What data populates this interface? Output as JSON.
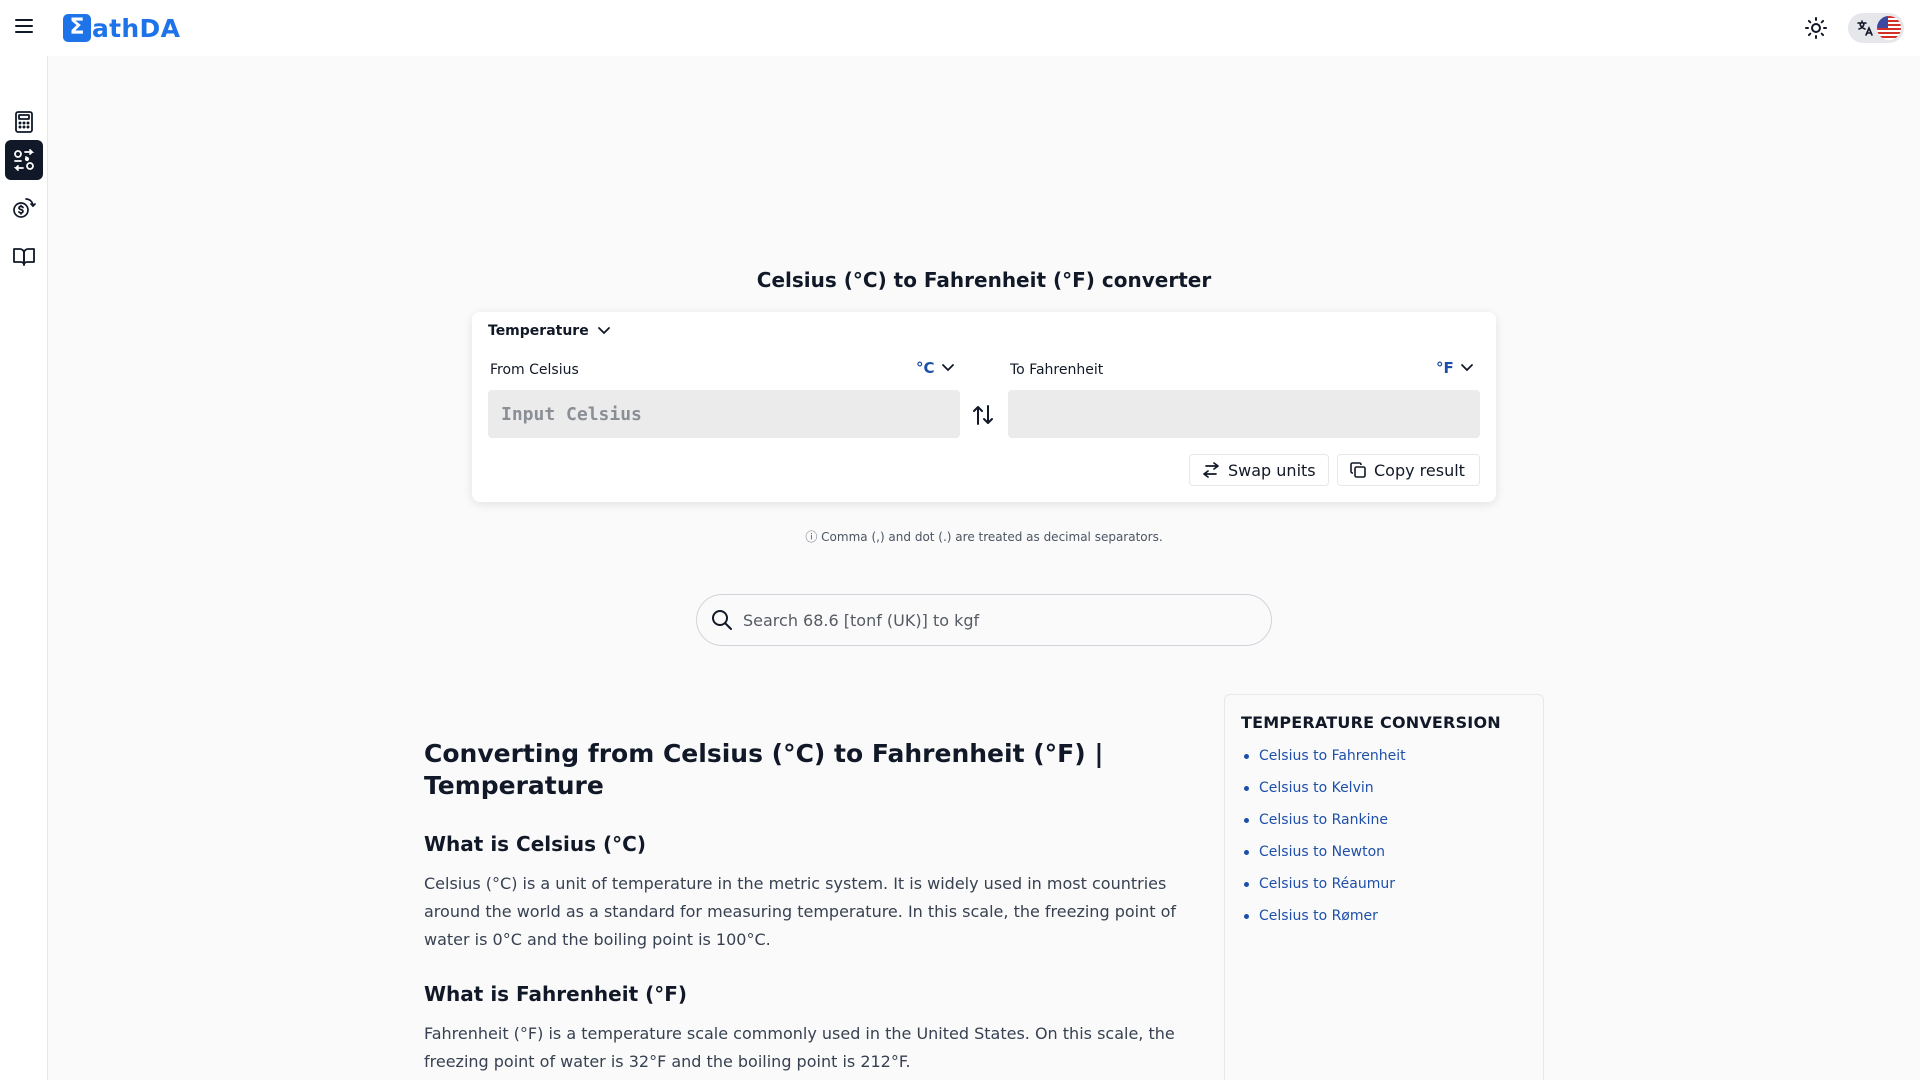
{
  "header": {
    "logo_text": "athDA",
    "logo_mark": "Σ",
    "menu_icon": "hamburger-menu-icon",
    "theme_icon": "sun-icon",
    "language_icon": "translate-icon",
    "flag": "us-flag"
  },
  "rail": {
    "items": [
      {
        "name": "calculator",
        "icon": "calculator-icon"
      },
      {
        "name": "unit-converter",
        "icon": "unit-convert-icon",
        "active": true
      },
      {
        "name": "currency-converter",
        "icon": "currency-exchange-icon"
      },
      {
        "name": "docs",
        "icon": "book-open-icon"
      }
    ]
  },
  "converter": {
    "title": "Celsius (°C) to Fahrenheit (°F) converter",
    "category": "Temperature",
    "from_label": "From Celsius",
    "to_label": "To Fahrenheit",
    "from_unit": "°C",
    "to_unit": "°F",
    "input_placeholder": "Input Celsius",
    "output_value": "",
    "swap_units_label": "Swap units",
    "copy_result_label": "Copy result",
    "hint": "ⓘ Comma (,) and dot (.) are treated as decimal separators."
  },
  "search": {
    "placeholder": "Search 68.6 [tonf (UK)] to kgf"
  },
  "article": {
    "title": "Converting from Celsius (°C) to Fahrenheit (°F) | Temperature",
    "sections": [
      {
        "heading": "What is Celsius (°C)",
        "text": "Celsius (°C) is a unit of temperature in the metric system. It is widely used in most countries around the world as a standard for measuring temperature. In this scale, the freezing point of water is 0°C and the boiling point is 100°C."
      },
      {
        "heading": "What is Fahrenheit (°F)",
        "text": "Fahrenheit (°F) is a temperature scale commonly used in the United States. On this scale, the freezing point of water is 32°F and the boiling point is 212°F."
      }
    ]
  },
  "sidebar_panel": {
    "title": "TEMPERATURE CONVERSION",
    "links": [
      "Celsius to Fahrenheit",
      "Celsius to Kelvin",
      "Celsius to Rankine",
      "Celsius to Newton",
      "Celsius to Réaumur",
      "Celsius to Rømer"
    ]
  },
  "colors": {
    "brand": "#1e73e8",
    "link": "#1e4fa8",
    "active_rail": "#111827",
    "background": "#fafafa"
  }
}
